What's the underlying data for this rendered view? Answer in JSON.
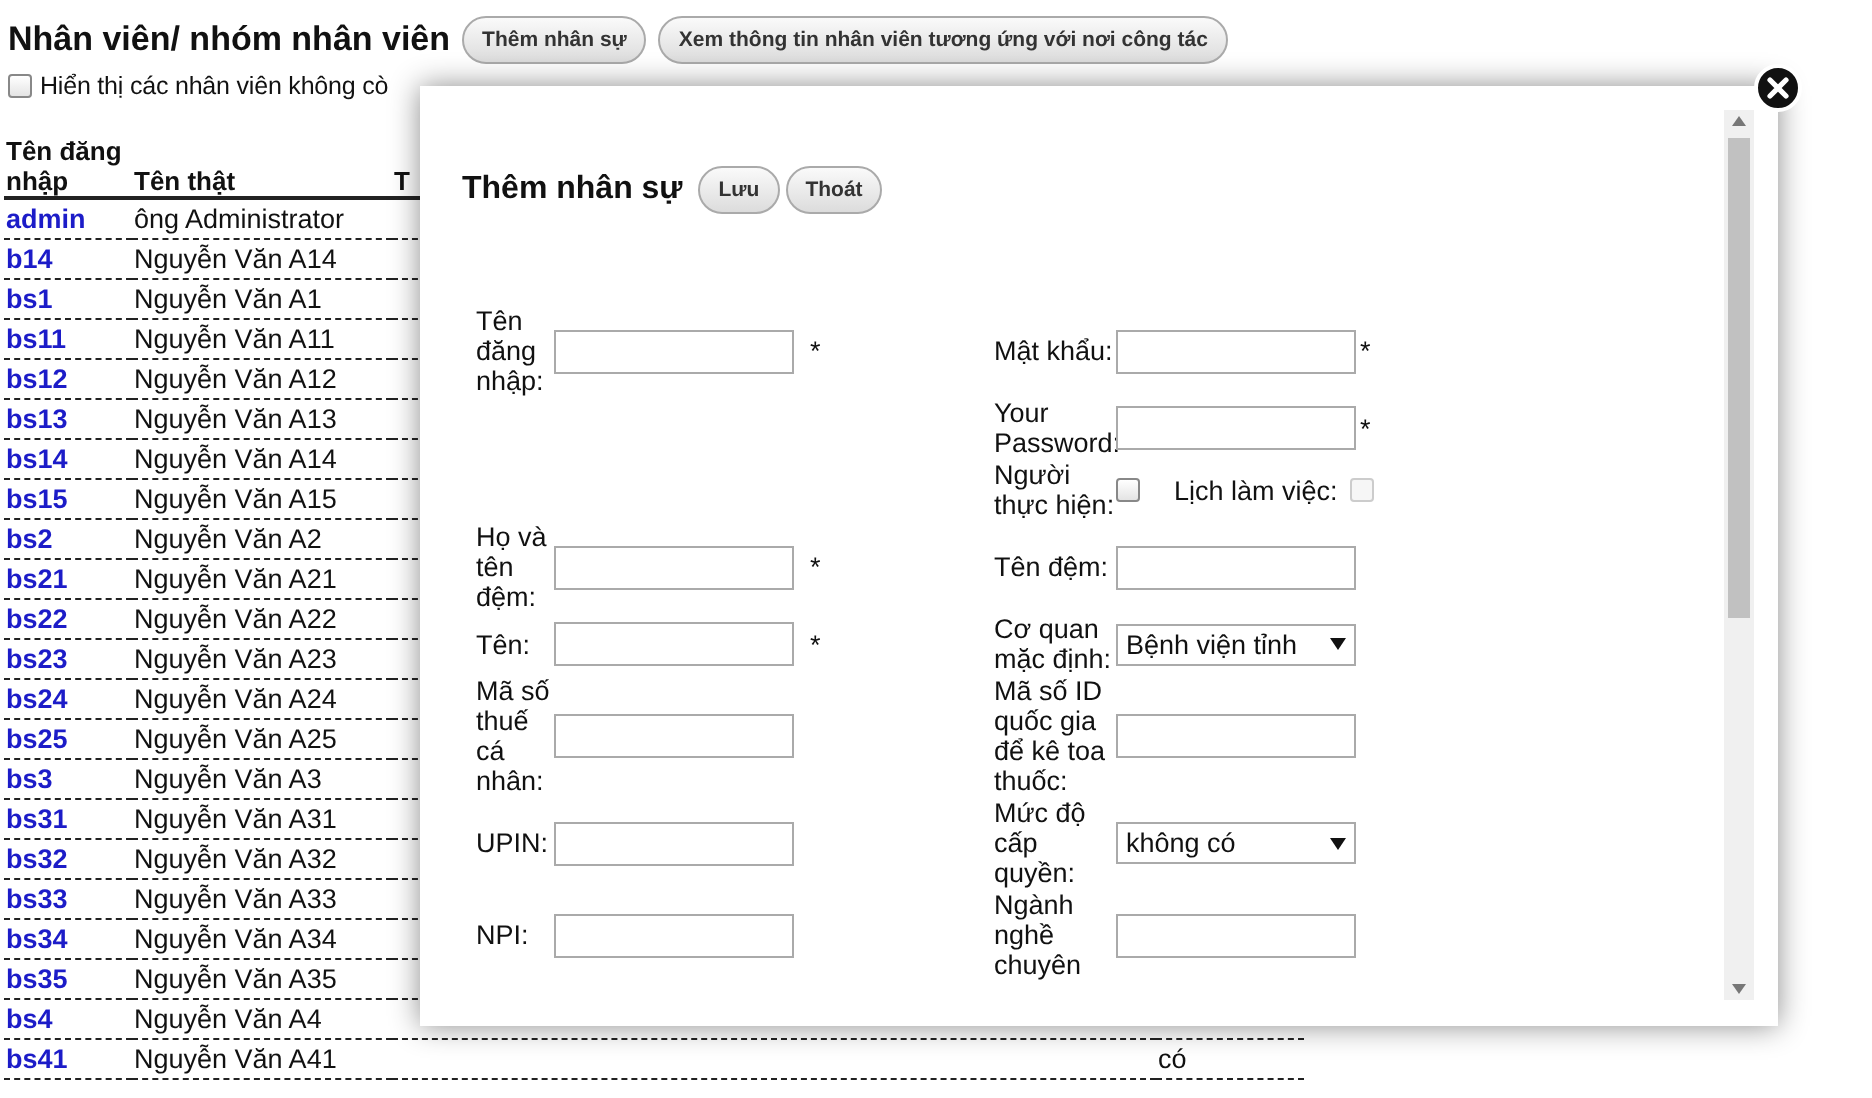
{
  "page": {
    "title": "Nhân viên/ nhóm nhân viên",
    "buttons": [
      "Thêm nhân sự",
      "Xem thông tin nhân viên tương ứng với nơi công tác"
    ],
    "show_inactive": {
      "label": "Hiển thị các nhân viên không cò",
      "checked": false
    }
  },
  "table": {
    "columns": [
      "Tên đăng nhập",
      "Tên thật",
      "T"
    ],
    "rows": [
      {
        "login": "admin",
        "name": "ông Administrator"
      },
      {
        "login": "b14",
        "name": "Nguyễn Văn A14"
      },
      {
        "login": "bs1",
        "name": "Nguyễn Văn A1"
      },
      {
        "login": "bs11",
        "name": "Nguyễn Văn A11"
      },
      {
        "login": "bs12",
        "name": "Nguyễn Văn A12"
      },
      {
        "login": "bs13",
        "name": "Nguyễn Văn A13"
      },
      {
        "login": "bs14",
        "name": "Nguyễn Văn A14"
      },
      {
        "login": "bs15",
        "name": "Nguyễn Văn A15"
      },
      {
        "login": "bs2",
        "name": "Nguyễn Văn A2"
      },
      {
        "login": "bs21",
        "name": "Nguyễn Văn A21"
      },
      {
        "login": "bs22",
        "name": "Nguyễn Văn A22"
      },
      {
        "login": "bs23",
        "name": "Nguyễn Văn A23"
      },
      {
        "login": "bs24",
        "name": "Nguyễn Văn A24"
      },
      {
        "login": "bs25",
        "name": "Nguyễn Văn A25"
      },
      {
        "login": "bs3",
        "name": "Nguyễn Văn A3"
      },
      {
        "login": "bs31",
        "name": "Nguyễn Văn A31"
      },
      {
        "login": "bs32",
        "name": "Nguyễn Văn A32"
      },
      {
        "login": "bs33",
        "name": "Nguyễn Văn A33"
      },
      {
        "login": "bs34",
        "name": "Nguyễn Văn A34"
      },
      {
        "login": "bs35",
        "name": "Nguyễn Văn A35"
      },
      {
        "login": "bs4",
        "name": "Nguyễn Văn A4"
      },
      {
        "login": "bs41",
        "name": "Nguyễn Văn A41",
        "column_4": "có"
      }
    ]
  },
  "dialog": {
    "title": "Thêm nhân sự",
    "buttons": [
      "Lưu",
      "Thoát"
    ],
    "rows": [
      {
        "left": {
          "kind": "text",
          "label": "Tên đăng nhập:",
          "mark": "*"
        },
        "right": {
          "kind": "text",
          "label": "Mật khẩu:",
          "mark": "*"
        }
      },
      {
        "right": {
          "kind": "text",
          "label": "Your Password:",
          "mark": "*"
        }
      },
      {
        "right": {
          "kind": "checks",
          "items": [
            {
              "label": "Người thực hiện:",
              "checked": false,
              "disabled": false
            },
            {
              "label": "Lịch làm việc:",
              "checked": false,
              "disabled": true
            }
          ]
        }
      },
      {
        "left": {
          "kind": "text",
          "label": "Họ và tên đệm:",
          "mark": "*"
        },
        "right": {
          "kind": "text",
          "label": "Tên đệm:"
        }
      },
      {
        "left": {
          "kind": "text",
          "label": "Tên:",
          "mark": "*"
        },
        "right": {
          "kind": "select",
          "label": "Cơ quan mặc định:",
          "value": "Bệnh viện tỉnh"
        }
      },
      {
        "left": {
          "kind": "text",
          "label": "Mã số thuế cá nhân:"
        },
        "right": {
          "kind": "text",
          "label": "Mã số ID quốc gia để kê toa thuốc:"
        }
      },
      {
        "left": {
          "kind": "text",
          "label": "UPIN:"
        },
        "right": {
          "kind": "select",
          "label": "Mức độ cấp quyền:",
          "value": "không có"
        }
      },
      {
        "left": {
          "kind": "text",
          "label": "NPI:"
        },
        "right": {
          "kind": "text",
          "label": "Ngành nghề chuyên"
        }
      }
    ]
  }
}
